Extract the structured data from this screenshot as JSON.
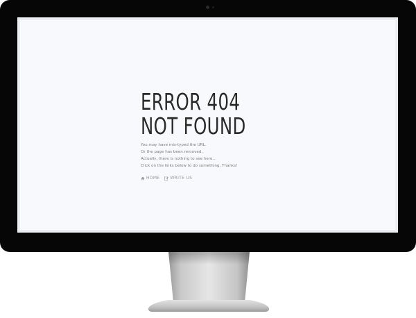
{
  "error": {
    "title_line1": "ERROR 404",
    "title_line2": "NOT FOUND",
    "message_lines": [
      "You may have mis-typed the URL.",
      "Or the page has been removed.",
      "Actually, there is nothing to see here...",
      "Click on the links below to do something, Thanks!"
    ]
  },
  "links": {
    "home_label": "HOME",
    "write_label": "WRITE US"
  },
  "icons": {
    "home": "home-icon",
    "write": "edit-icon"
  },
  "colors": {
    "bezel": "#060606",
    "screen": "#f8f9fc",
    "title": "#2a2a2a",
    "text": "#7a7a7a",
    "link": "#9a9a9a"
  }
}
